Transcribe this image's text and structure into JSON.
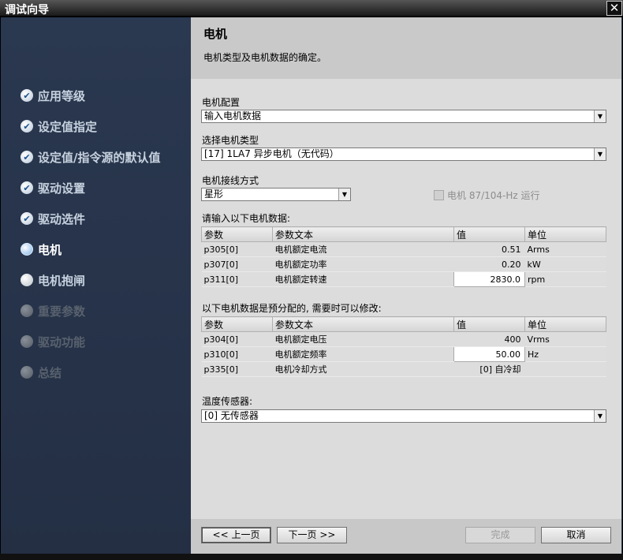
{
  "window": {
    "title": "调试向导",
    "close_icon": "close-icon"
  },
  "sidebar": {
    "steps": [
      {
        "label": "应用等级",
        "state": "done"
      },
      {
        "label": "设定值指定",
        "state": "done"
      },
      {
        "label": "设定值/指令源的默认值",
        "state": "done"
      },
      {
        "label": "驱动设置",
        "state": "done"
      },
      {
        "label": "驱动选件",
        "state": "done"
      },
      {
        "label": "电机",
        "state": "current"
      },
      {
        "label": "电机抱闸",
        "state": "todo"
      },
      {
        "label": "重要参数",
        "state": "disabled"
      },
      {
        "label": "驱动功能",
        "state": "disabled"
      },
      {
        "label": "总结",
        "state": "disabled"
      }
    ],
    "check_glyph": "✔"
  },
  "header": {
    "title": "电机",
    "subtitle": "电机类型及电机数据的确定。"
  },
  "form": {
    "motor_config_label": "电机配置",
    "motor_config_value": "输入电机数据",
    "motor_type_label": "选择电机类型",
    "motor_type_value": "[17] 1LA7 异步电机（无代码）",
    "wiring_label": "电机接线方式",
    "wiring_value": "星形",
    "hz87_label": "电机 87/104-Hz 运行",
    "dropdown_glyph": "▼"
  },
  "table1": {
    "caption": "请输入以下电机数据:",
    "headers": [
      "参数",
      "参数文本",
      "值",
      "单位"
    ],
    "rows": [
      [
        "p305[0]",
        "电机额定电流",
        "0.51",
        "Arms"
      ],
      [
        "p307[0]",
        "电机额定功率",
        "0.20",
        "kW"
      ],
      [
        "p311[0]",
        "电机额定转速",
        "2830.0",
        "rpm"
      ]
    ]
  },
  "table2": {
    "caption": "以下电机数据是预分配的, 需要时可以修改:",
    "headers": [
      "参数",
      "参数文本",
      "值",
      "单位"
    ],
    "rows": [
      [
        "p304[0]",
        "电机额定电压",
        "400",
        "Vrms"
      ],
      [
        "p310[0]",
        "电机额定频率",
        "50.00",
        "Hz"
      ],
      [
        "p335[0]",
        "电机冷却方式",
        "[0] 自冷却",
        ""
      ]
    ]
  },
  "temp_sensor": {
    "label": "温度传感器:",
    "value": "[0] 无传感器"
  },
  "footer": {
    "prev": "<< 上一页",
    "next": "下一页 >>",
    "finish": "完成",
    "cancel": "取消"
  }
}
